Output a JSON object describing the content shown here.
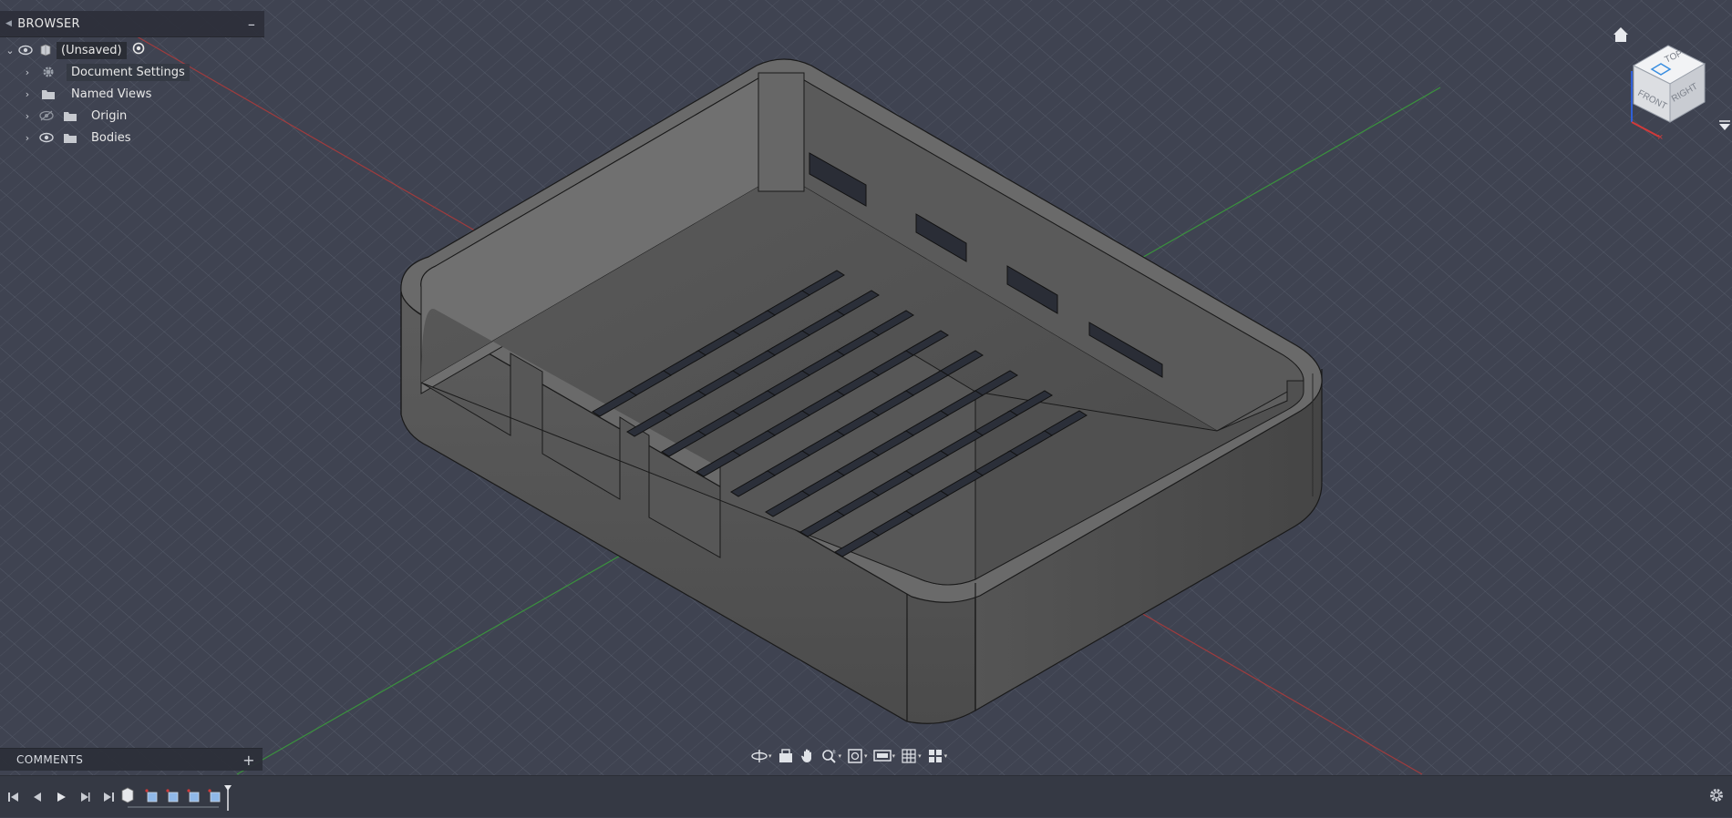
{
  "browser": {
    "title": "BROWSER",
    "root_label": "(Unsaved)",
    "items": [
      {
        "label": "Document Settings",
        "icon": "gear-icon"
      },
      {
        "label": "Named Views",
        "icon": "folder-icon"
      },
      {
        "label": "Origin",
        "icon": "folder-icon",
        "visibility": "hidden"
      },
      {
        "label": "Bodies",
        "icon": "folder-icon",
        "visibility": "visible"
      }
    ]
  },
  "comments": {
    "title": "COMMENTS"
  },
  "viewcube": {
    "top": "TOP",
    "front": "FRONT",
    "right": "RIGHT"
  },
  "navbar": {
    "tools": [
      "orbit-icon",
      "look-at-icon",
      "pan-icon",
      "zoom-icon",
      "fit-icon",
      "display-settings-icon",
      "grid-icon",
      "viewports-icon"
    ]
  },
  "timeline": {
    "controls": [
      "go-to-start-icon",
      "step-back-icon",
      "play-icon",
      "step-forward-icon",
      "go-to-end-icon"
    ],
    "features": [
      "component-icon",
      "extrude-feature-icon",
      "extrude-feature-icon",
      "extrude-feature-icon",
      "extrude-feature-icon"
    ]
  },
  "colors": {
    "background": "#3e4250",
    "grid": "#5c6270",
    "model": "#6b6b6b",
    "axis_x": "#b23a3a",
    "axis_y": "#3aa03a"
  }
}
